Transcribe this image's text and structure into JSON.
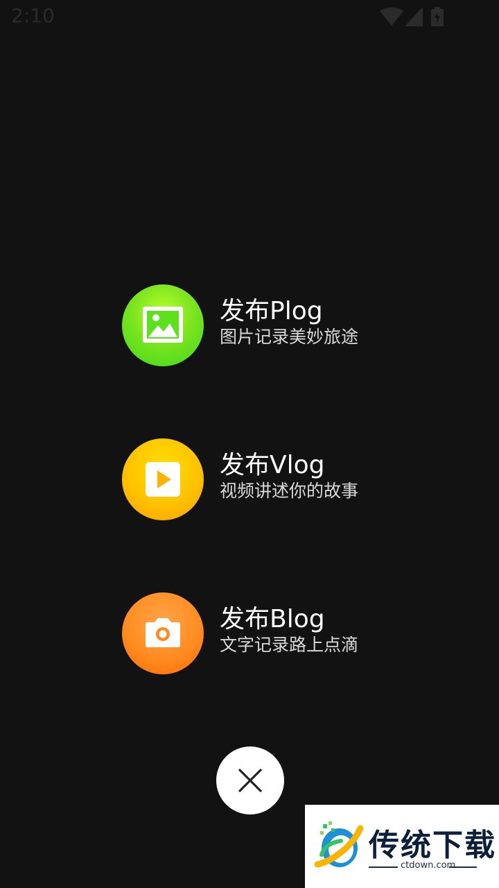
{
  "status_bar": {
    "time": "2:10",
    "icons": [
      "wifi-icon",
      "cell-signal-icon",
      "battery-charging-icon"
    ]
  },
  "actions": [
    {
      "title": "发布Plog",
      "subtitle": "图片记录美妙旅途",
      "icon": "image-icon",
      "color": "#5ee01e"
    },
    {
      "title": "发布Vlog",
      "subtitle": "视频讲述你的故事",
      "icon": "play-icon",
      "color": "#ffc000"
    },
    {
      "title": "发布Blog",
      "subtitle": "文字记录路上点滴",
      "icon": "camera-icon",
      "color": "#ff8a1e"
    }
  ],
  "close_button": {
    "icon": "close-icon"
  },
  "watermark": {
    "brand": "传统下载",
    "url": "ctdown.com"
  },
  "colors": {
    "background": "#121212",
    "text_primary": "#ffffff",
    "text_secondary": "#d9d9d9"
  }
}
